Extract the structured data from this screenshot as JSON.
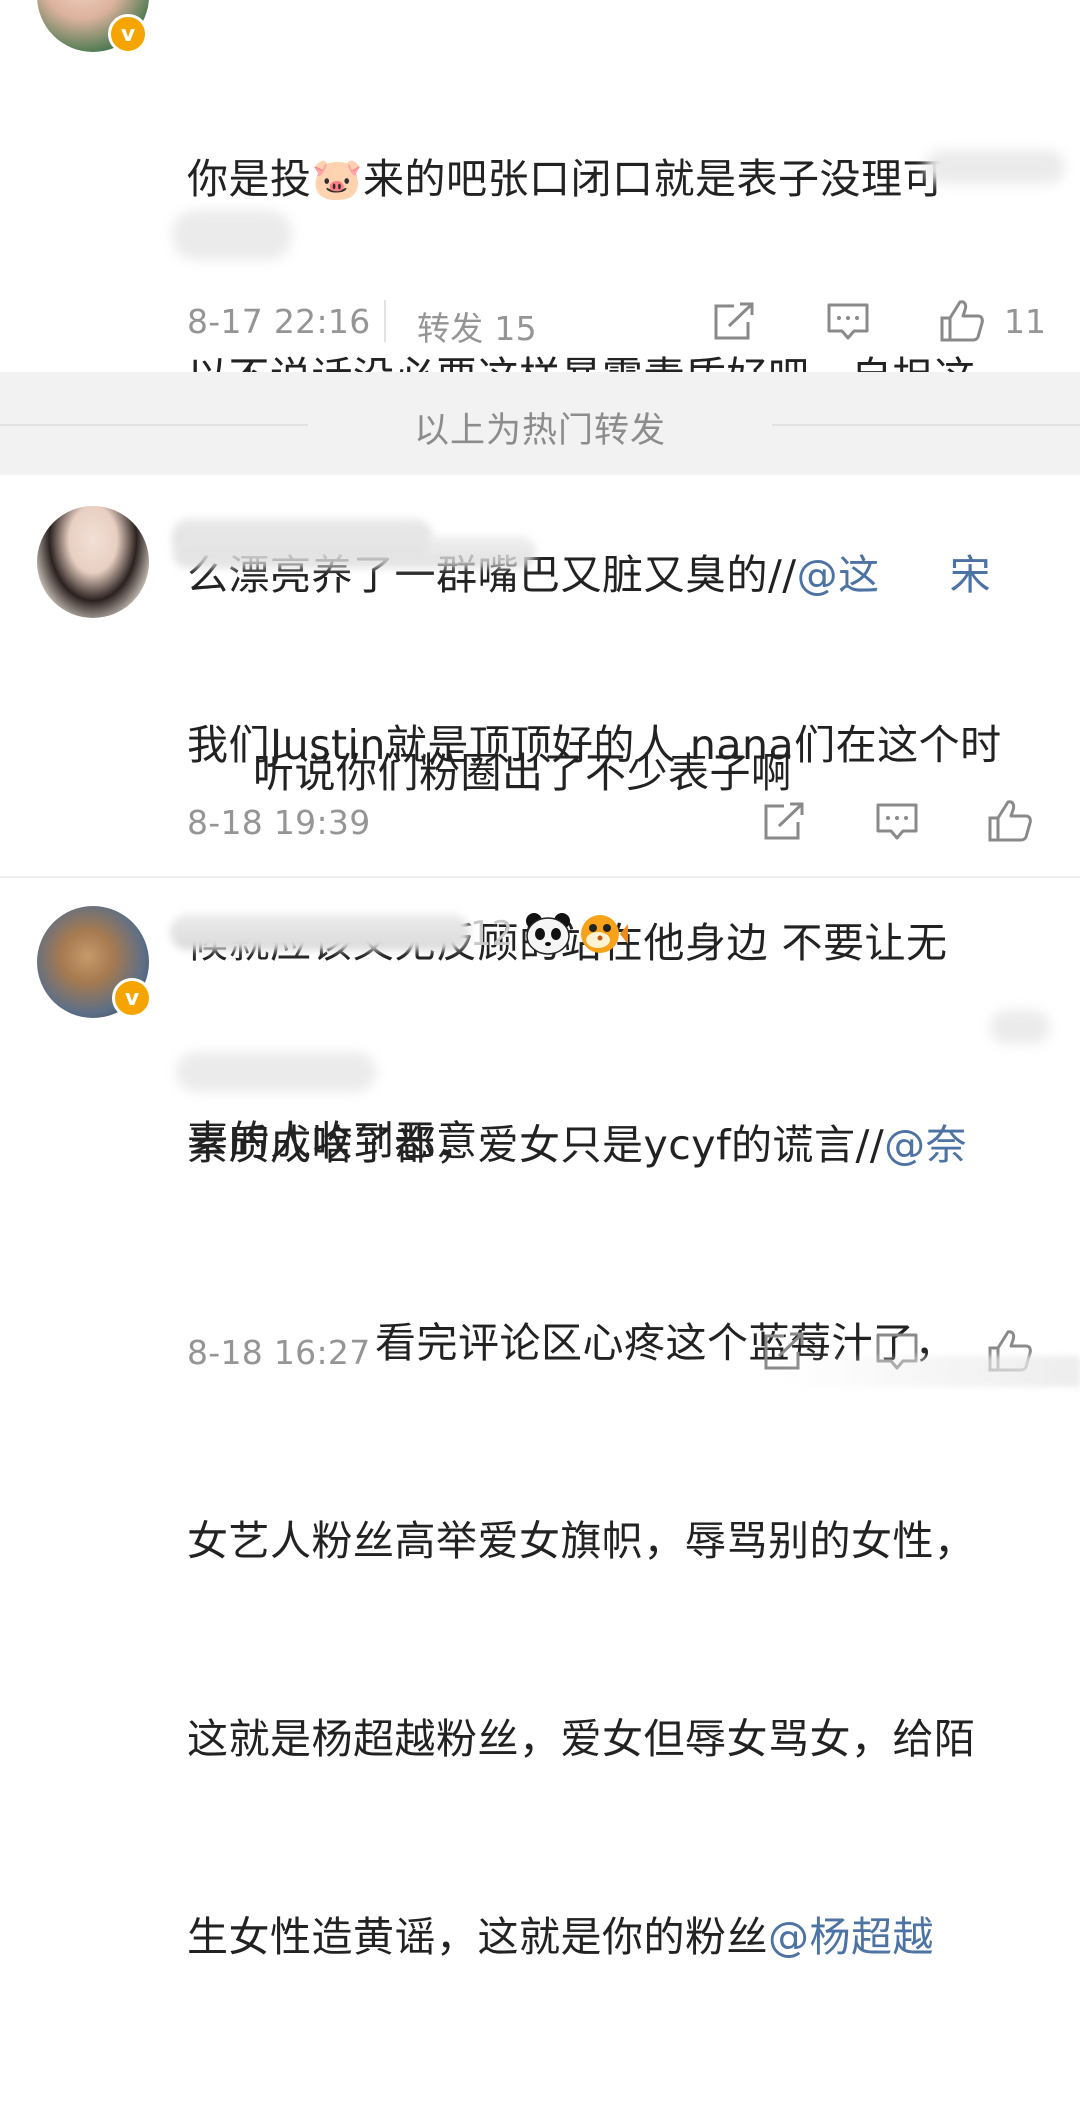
{
  "comments": [
    {
      "text_lines": [
        "你是投🐷来的吧张口闭口就是表子没理可",
        "以不说话没必要这样暴露素质好吧，自担这",
        "么漂亮养了一群嘴巴又脏又臭的//",
        "听说你们粉圈出了不少表子啊"
      ],
      "mention_partial": "@这",
      "mention_partial_2": "宋",
      "timestamp": "8-17 22:16",
      "repost_label": "转发 15",
      "like_count": "11",
      "verified_badge": "v"
    },
    {
      "text_lines": [
        "我们Justin就是顶顶好的人 nana们在这个时",
        "候就应该义无反顾的站在他身边 不要让无",
        "辜的人收到恶意"
      ],
      "timestamp": "8-18 19:39"
    },
    {
      "username_fragment": "12",
      "text_lines": [
        "素质成啥了都，爱女只是ycyf的谎言//",
        "看完评论区心疼这个蓝莓汁了，",
        "女艺人粉丝高举爱女旗帜，辱骂别的女性，",
        "这就是杨超越粉丝，爱女但辱女骂女，给陌",
        "生女性造黄谣，这就是你的粉丝"
      ],
      "mention_partial": "@奈",
      "mention_end": "@杨超越",
      "timestamp": "8-18 16:27",
      "verified_badge": "v"
    }
  ],
  "divider": {
    "label": "以上为热门转发"
  },
  "icons": {
    "repost": "share-square-icon",
    "comment": "comment-bubble-icon",
    "like": "thumbs-up-icon",
    "panda": "panda-emoji-icon",
    "fish": "pufferfish-emoji-icon"
  },
  "colors": {
    "mention": "#4d72a4",
    "meta_gray": "#959595",
    "badge": "#f6a500",
    "divider_band": "#f2f2f2"
  }
}
